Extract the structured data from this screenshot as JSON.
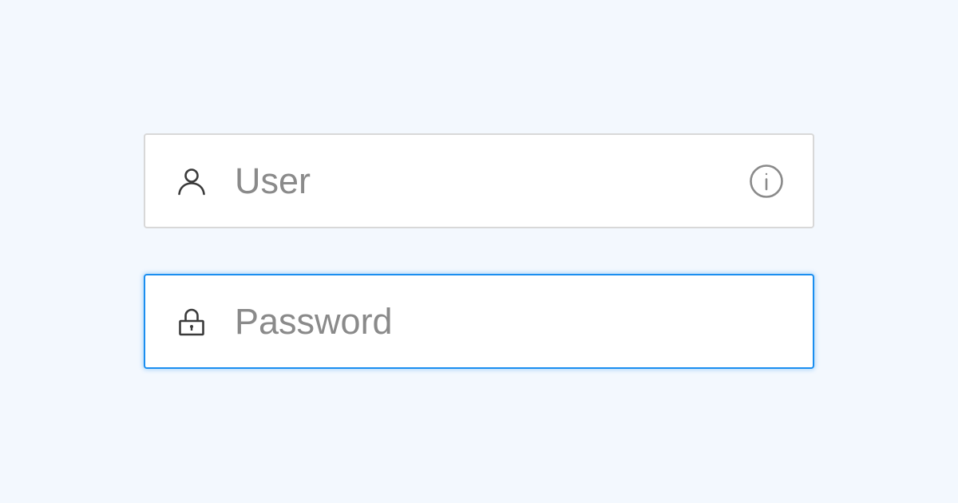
{
  "form": {
    "user_field": {
      "placeholder": "User",
      "value": "",
      "leading_icon": "user-icon",
      "trailing_icon": "info-icon"
    },
    "password_field": {
      "placeholder": "Password",
      "value": "",
      "leading_icon": "lock-icon",
      "focused": true
    }
  },
  "colors": {
    "page_background": "#f3f8fe",
    "field_background": "#ffffff",
    "field_border": "#d8d8d8",
    "focus_border": "#1b8ef0",
    "placeholder_text": "#8a8a8a",
    "icon_dark": "#3a3a3a",
    "icon_muted": "#8a8a8a"
  }
}
